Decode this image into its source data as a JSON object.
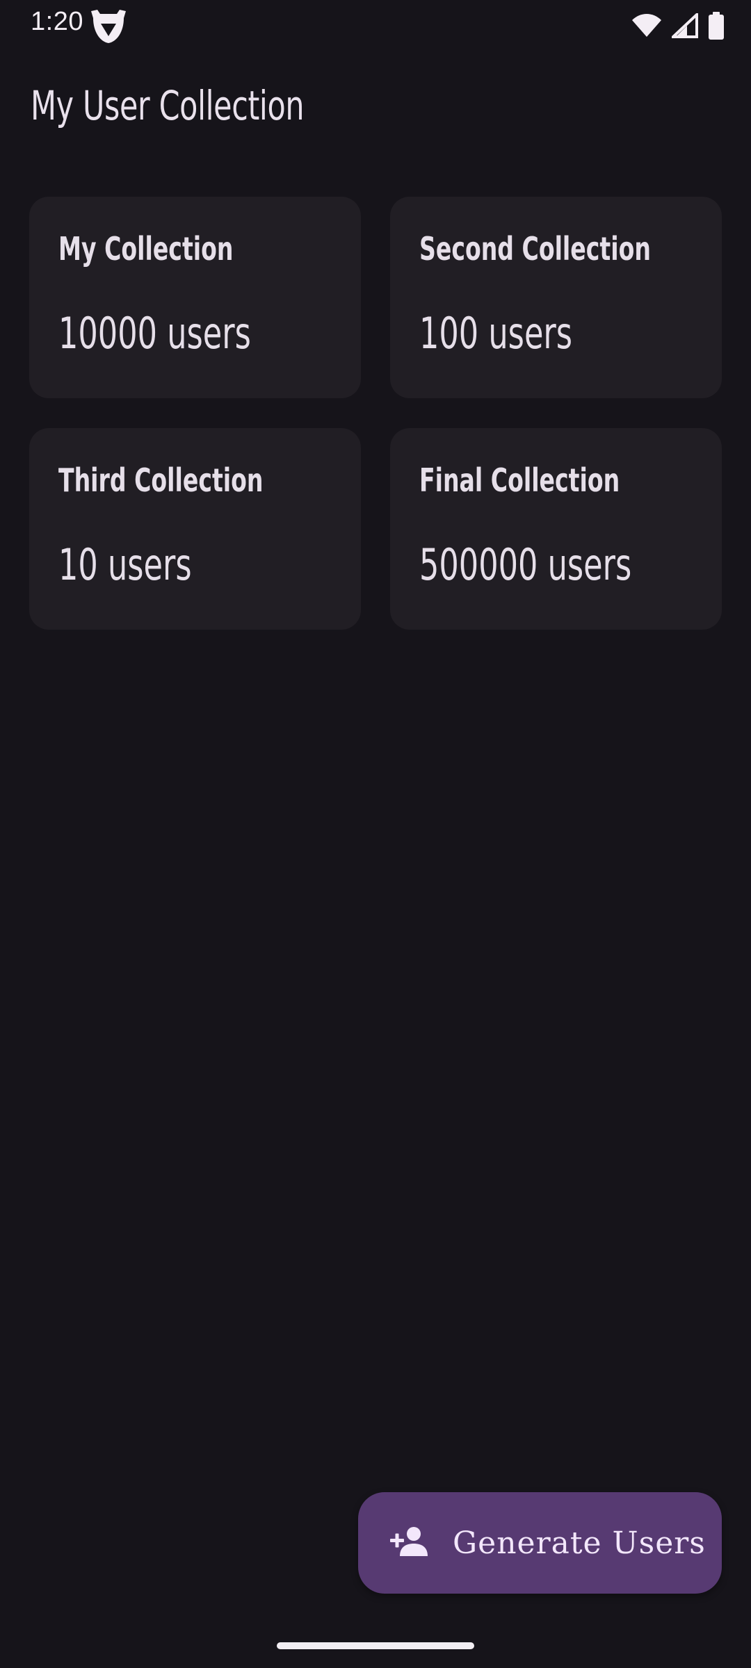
{
  "status_bar": {
    "time": "1:20",
    "icons": [
      "app-notification-icon",
      "wifi-icon",
      "cell-signal-icon",
      "battery-icon"
    ]
  },
  "header": {
    "title": "My User Collection"
  },
  "collections": [
    {
      "title": "My Collection",
      "count": "10000 users"
    },
    {
      "title": "Second Collection",
      "count": "100 users"
    },
    {
      "title": "Third Collection",
      "count": "10 users"
    },
    {
      "title": "Final Collection",
      "count": "500000 users"
    }
  ],
  "fab": {
    "label": "Generate Users",
    "icon": "person-add-icon"
  },
  "colors": {
    "background": "#16141a",
    "card": "#211e24",
    "fab": "#573a72",
    "text": "#e8e1ea"
  }
}
